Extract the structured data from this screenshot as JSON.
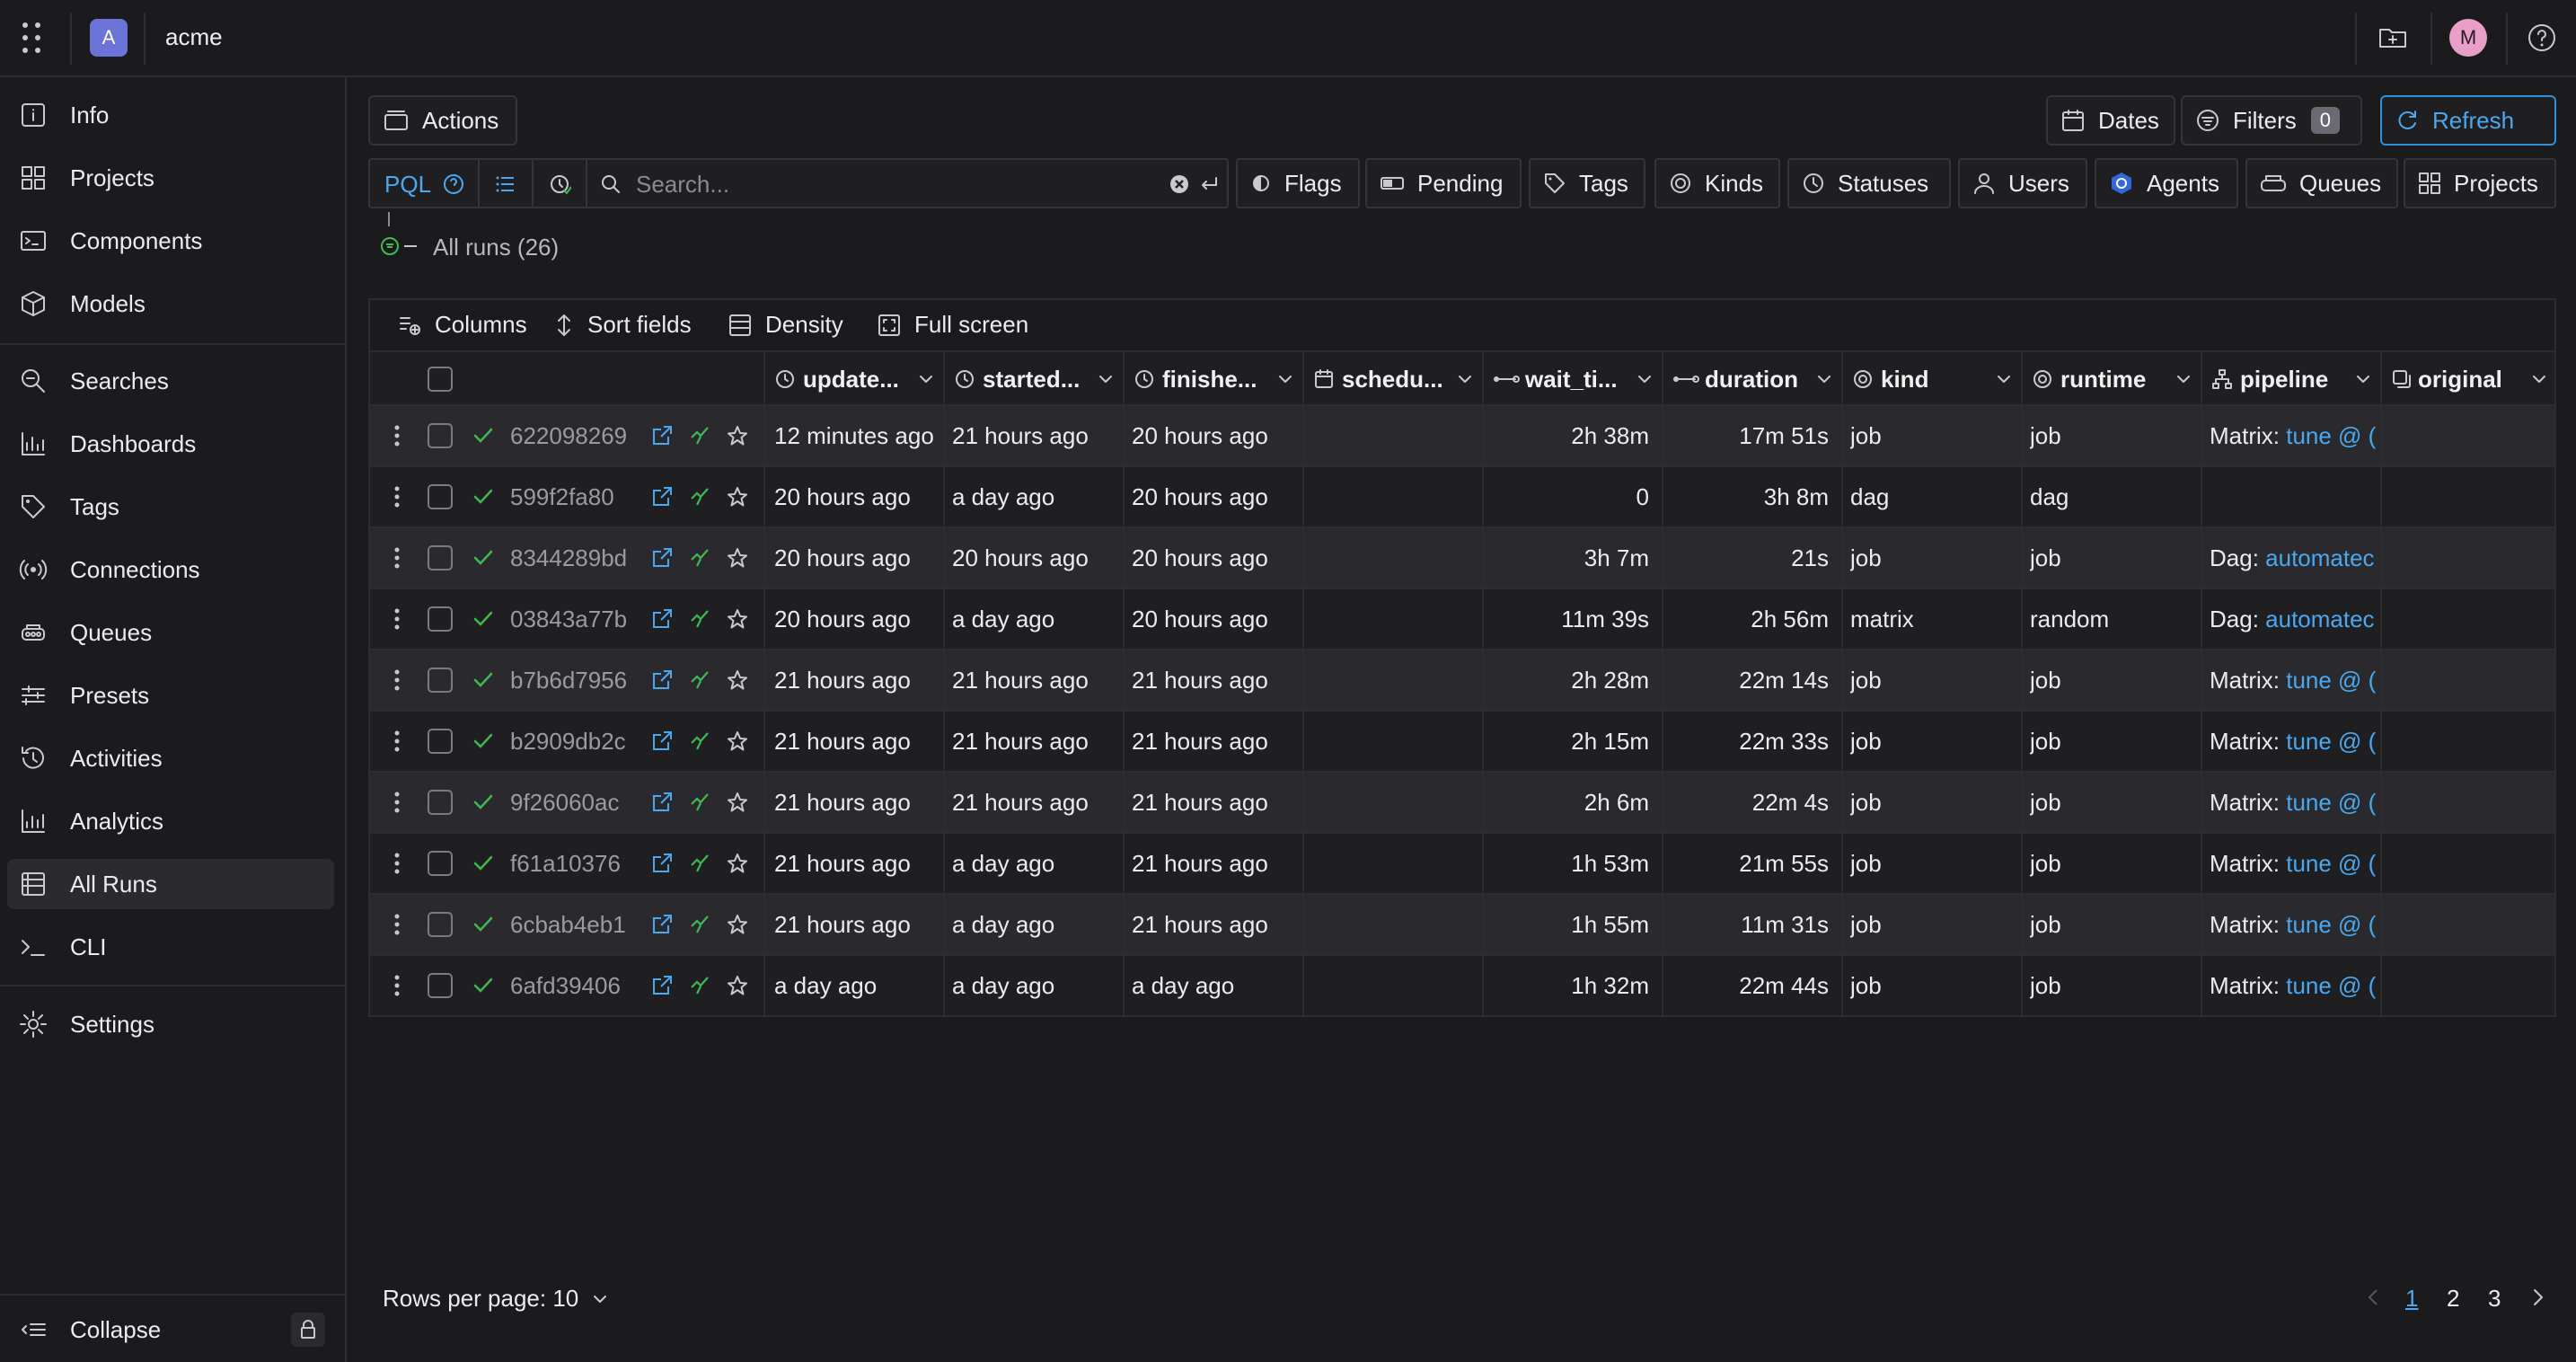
{
  "header": {
    "org_initial": "A",
    "org_name": "acme",
    "user_initial": "M"
  },
  "sidebar": {
    "items": [
      {
        "label": "Info",
        "icon": "info-icon"
      },
      {
        "label": "Projects",
        "icon": "projects-icon"
      },
      {
        "label": "Components",
        "icon": "components-icon"
      },
      {
        "label": "Models",
        "icon": "models-icon"
      },
      {
        "label": "Searches",
        "icon": "searches-icon"
      },
      {
        "label": "Dashboards",
        "icon": "dashboards-icon"
      },
      {
        "label": "Tags",
        "icon": "tag-icon"
      },
      {
        "label": "Connections",
        "icon": "connections-icon"
      },
      {
        "label": "Queues",
        "icon": "queues-icon"
      },
      {
        "label": "Presets",
        "icon": "presets-icon"
      },
      {
        "label": "Activities",
        "icon": "activities-icon"
      },
      {
        "label": "Analytics",
        "icon": "analytics-icon"
      },
      {
        "label": "All Runs",
        "icon": "all-runs-icon",
        "active": true
      },
      {
        "label": "CLI",
        "icon": "cli-icon"
      },
      {
        "label": "Settings",
        "icon": "settings-icon"
      }
    ],
    "collapse_label": "Collapse"
  },
  "actions_label": "Actions",
  "top_buttons": {
    "dates": "Dates",
    "filters": "Filters",
    "filters_count": "0",
    "refresh": "Refresh"
  },
  "search": {
    "mode": "PQL",
    "placeholder": "Search..."
  },
  "filter_chips": [
    "Flags",
    "Pending",
    "Tags",
    "Kinds",
    "Statuses",
    "Users",
    "Agents",
    "Queues",
    "Projects"
  ],
  "all_runs_label": "All runs (26)",
  "table_toolbar": {
    "columns": "Columns",
    "sort": "Sort fields",
    "density": "Density",
    "fullscreen": "Full screen"
  },
  "table": {
    "headers": [
      "update...",
      "started...",
      "finishe...",
      "schedu...",
      "wait_ti...",
      "duration",
      "kind",
      "runtime",
      "pipeline",
      "original"
    ],
    "rows": [
      {
        "uuid": "622098269",
        "updated": "12 minutes ago",
        "started": "21 hours ago",
        "finished": "20 hours ago",
        "wait": "2h 38m",
        "duration": "17m 51s",
        "kind": "job",
        "runtime": "job",
        "pipeline_prefix": "Matrix: ",
        "pipeline_link": "tune @ ("
      },
      {
        "uuid": "599f2fa80",
        "updated": "20 hours ago",
        "started": "a day ago",
        "finished": "20 hours ago",
        "wait": "0",
        "duration": "3h 8m",
        "kind": "dag",
        "runtime": "dag",
        "pipeline_prefix": "",
        "pipeline_link": ""
      },
      {
        "uuid": "8344289bd",
        "updated": "20 hours ago",
        "started": "20 hours ago",
        "finished": "20 hours ago",
        "wait": "3h 7m",
        "duration": "21s",
        "kind": "job",
        "runtime": "job",
        "pipeline_prefix": "Dag: ",
        "pipeline_link": "automatec"
      },
      {
        "uuid": "03843a77b",
        "updated": "20 hours ago",
        "started": "a day ago",
        "finished": "20 hours ago",
        "wait": "11m 39s",
        "duration": "2h 56m",
        "kind": "matrix",
        "runtime": "random",
        "pipeline_prefix": "Dag: ",
        "pipeline_link": "automatec"
      },
      {
        "uuid": "b7b6d7956",
        "updated": "21 hours ago",
        "started": "21 hours ago",
        "finished": "21 hours ago",
        "wait": "2h 28m",
        "duration": "22m 14s",
        "kind": "job",
        "runtime": "job",
        "pipeline_prefix": "Matrix: ",
        "pipeline_link": "tune @ ("
      },
      {
        "uuid": "b2909db2c",
        "updated": "21 hours ago",
        "started": "21 hours ago",
        "finished": "21 hours ago",
        "wait": "2h 15m",
        "duration": "22m 33s",
        "kind": "job",
        "runtime": "job",
        "pipeline_prefix": "Matrix: ",
        "pipeline_link": "tune @ ("
      },
      {
        "uuid": "9f26060ac",
        "updated": "21 hours ago",
        "started": "21 hours ago",
        "finished": "21 hours ago",
        "wait": "2h 6m",
        "duration": "22m 4s",
        "kind": "job",
        "runtime": "job",
        "pipeline_prefix": "Matrix: ",
        "pipeline_link": "tune @ ("
      },
      {
        "uuid": "f61a10376",
        "updated": "21 hours ago",
        "started": "a day ago",
        "finished": "21 hours ago",
        "wait": "1h 53m",
        "duration": "21m 55s",
        "kind": "job",
        "runtime": "job",
        "pipeline_prefix": "Matrix: ",
        "pipeline_link": "tune @ ("
      },
      {
        "uuid": "6cbab4eb1",
        "updated": "21 hours ago",
        "started": "a day ago",
        "finished": "21 hours ago",
        "wait": "1h 55m",
        "duration": "11m 31s",
        "kind": "job",
        "runtime": "job",
        "pipeline_prefix": "Matrix: ",
        "pipeline_link": "tune @ ("
      },
      {
        "uuid": "6afd39406",
        "updated": "a day ago",
        "started": "a day ago",
        "finished": "a day ago",
        "wait": "1h 32m",
        "duration": "22m 44s",
        "kind": "job",
        "runtime": "job",
        "pipeline_prefix": "Matrix: ",
        "pipeline_link": "tune @ ("
      }
    ]
  },
  "pagination": {
    "rows_per_page": "Rows per page: 10",
    "pages": [
      "1",
      "2",
      "3"
    ],
    "current": "1"
  },
  "colors": {
    "accent": "#4aa8f0",
    "success": "#3fb950",
    "background": "#1b1b1e"
  }
}
